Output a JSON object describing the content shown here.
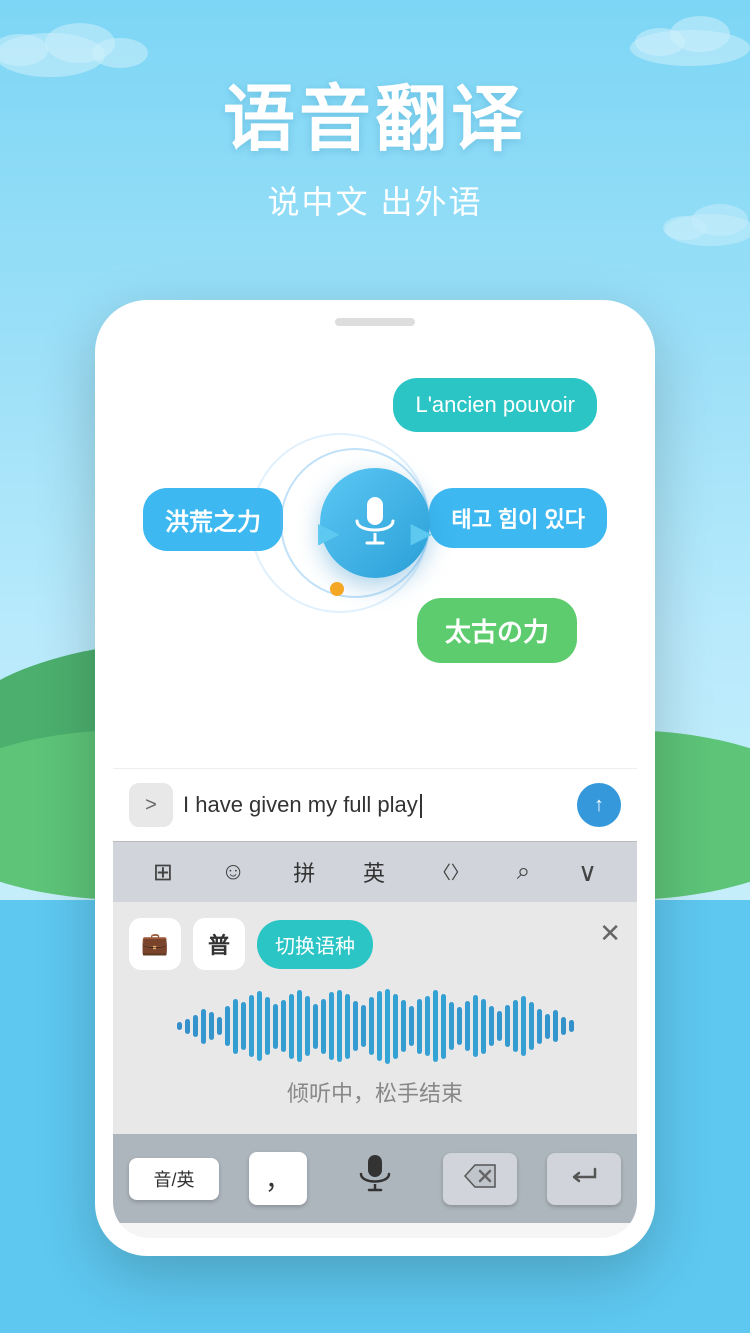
{
  "header": {
    "main_title": "语音翻译",
    "sub_title": "说中文 出外语"
  },
  "bubbles": {
    "french": "L'ancien pouvoir",
    "chinese": "洪荒之力",
    "korean": "태고 힘이 있다",
    "japanese": "太古の力"
  },
  "input": {
    "text": "I have given my full play",
    "arrow_label": ">",
    "send_label": "↑"
  },
  "toolbar": {
    "grid_icon": "⊞",
    "emoji_icon": "☺",
    "pinyin_label": "拼",
    "english_label": "英",
    "symbol_label": "〈〉",
    "search_icon": "⌕",
    "more_icon": "∨"
  },
  "voice_panel": {
    "briefcase_icon": "💼",
    "speech_icon": "普",
    "switch_lang_label": "切换语种",
    "close_icon": "✕",
    "hint": "倾听中，松手结束"
  },
  "keyboard_bottom": {
    "input_mode": "音/英",
    "comma": "，",
    "mic_icon": "🎤",
    "delete_icon": "⌫",
    "enter_icon": "↵"
  },
  "waveform": {
    "bars": [
      8,
      15,
      22,
      35,
      28,
      18,
      40,
      55,
      48,
      62,
      70,
      58,
      45,
      52,
      65,
      72,
      60,
      45,
      55,
      68,
      72,
      65,
      50,
      42,
      58,
      70,
      75,
      65,
      52,
      40,
      55,
      60,
      72,
      65,
      48,
      38,
      50,
      62,
      55,
      40,
      30,
      42,
      52,
      60,
      48,
      35,
      25,
      32,
      18,
      12
    ]
  }
}
